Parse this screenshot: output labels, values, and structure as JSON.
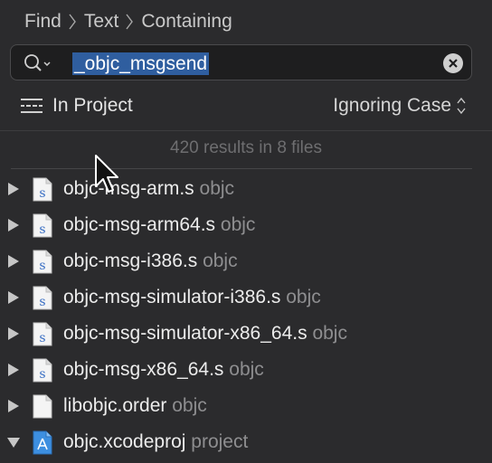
{
  "breadcrumb": {
    "items": [
      "Find",
      "Text",
      "Containing"
    ]
  },
  "search": {
    "value": "_objc_msgsend"
  },
  "scope": {
    "label": "In Project",
    "case_option": "Ignoring Case"
  },
  "results": {
    "summary": "420 results in 8 files"
  },
  "files": [
    {
      "name": "objc-msg-arm.s",
      "location": "objc",
      "icon": "source-file-icon",
      "expanded": false
    },
    {
      "name": "objc-msg-arm64.s",
      "location": "objc",
      "icon": "source-file-icon",
      "expanded": false
    },
    {
      "name": "objc-msg-i386.s",
      "location": "objc",
      "icon": "source-file-icon",
      "expanded": false
    },
    {
      "name": "objc-msg-simulator-i386.s",
      "location": "objc",
      "icon": "source-file-icon",
      "expanded": false
    },
    {
      "name": "objc-msg-simulator-x86_64.s",
      "location": "objc",
      "icon": "source-file-icon",
      "expanded": false
    },
    {
      "name": "objc-msg-x86_64.s",
      "location": "objc",
      "icon": "source-file-icon",
      "expanded": false
    },
    {
      "name": "libobjc.order",
      "location": "objc",
      "icon": "plain-file-icon",
      "expanded": false
    },
    {
      "name": "objc.xcodeproj",
      "location": "project",
      "icon": "xcodeproj-icon",
      "expanded": true
    }
  ],
  "colors": {
    "selection": "#2f5e9f",
    "background": "#2b2b2d",
    "field": "#1e1e1f"
  }
}
